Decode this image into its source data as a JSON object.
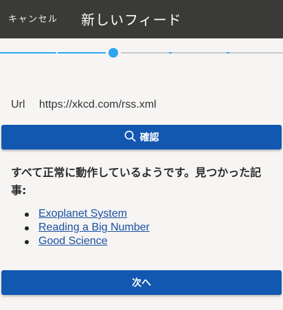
{
  "appbar": {
    "cancel_label": "キャンセル",
    "title": "新しいフィード",
    "background": "#3a3a38"
  },
  "stepper": {
    "step_count": 5,
    "current_step": 3,
    "active_color": "#2ea6f0",
    "inactive_color": "#c9c9c9"
  },
  "url_field": {
    "label": "Url",
    "value": "https://xkcd.com/rss.xml"
  },
  "confirm_button": {
    "icon": "search-icon",
    "label": "確認"
  },
  "result": {
    "message": "すべて正常に動作しているようです。見つかった記事:",
    "articles": [
      "Exoplanet System",
      "Reading a Big Number",
      "Good Science"
    ]
  },
  "next_button": {
    "label": "次へ"
  },
  "colors": {
    "primary": "#1257b0",
    "link": "#1a4fa0",
    "page_background": "#f6f5f4"
  }
}
